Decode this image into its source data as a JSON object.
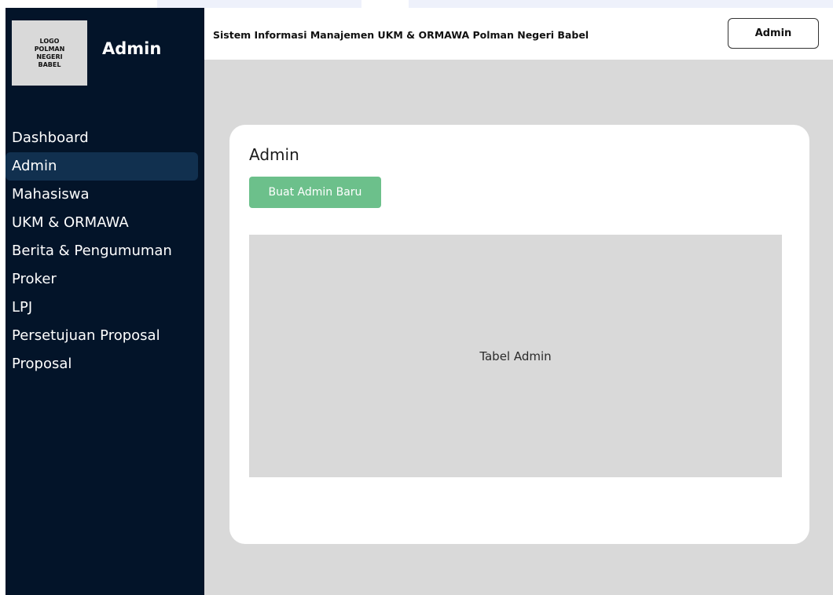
{
  "sidebar": {
    "logo_text": "LOGO\nPOLMAN\nNEGERI\nBABEL",
    "brand": "Admin",
    "items": [
      {
        "label": "Dashboard"
      },
      {
        "label": "Admin"
      },
      {
        "label": "Mahasiswa"
      },
      {
        "label": "UKM & ORMAWA"
      },
      {
        "label": "Berita & Pengumuman"
      },
      {
        "label": "Proker"
      },
      {
        "label": "LPJ"
      },
      {
        "label": "Persetujuan Proposal"
      },
      {
        "label": "Proposal"
      }
    ],
    "active_item": "Admin"
  },
  "header": {
    "title": "Sistem Informasi Manajemen UKM & ORMAWA Polman Negeri Babel",
    "user_button": "Admin"
  },
  "main": {
    "card_title": "Admin",
    "create_button": "Buat Admin Baru",
    "table_placeholder": "Tabel Admin"
  },
  "colors": {
    "sidebar_bg": "#031429",
    "active_item_bg": "#11304f",
    "content_bg": "#d9d9d9",
    "accent_green": "#6cc08b"
  }
}
